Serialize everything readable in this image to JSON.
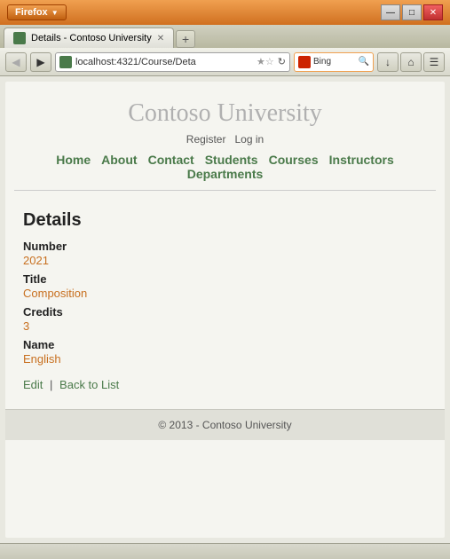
{
  "browser": {
    "firefox_label": "Firefox",
    "dropdown_arrow": "▼",
    "tab": {
      "label": "Details - Contoso University",
      "favicon_color": "#4a7a4a"
    },
    "new_tab_label": "+",
    "address": "localhost:4321/Course/Deta",
    "search_engine": "Bing",
    "window_controls": {
      "minimize": "—",
      "maximize": "□",
      "close": "✕"
    },
    "nav": {
      "back": "◀",
      "forward": "▶",
      "reload": "↺",
      "home": "⌂",
      "more1": "↓",
      "more2": "☰"
    }
  },
  "page": {
    "site_title": "Contoso University",
    "auth": {
      "register": "Register",
      "login": "Log in"
    },
    "nav_links": [
      "Home",
      "About",
      "Contact",
      "Students",
      "Courses",
      "Instructors",
      "Departments"
    ],
    "heading": "Details",
    "fields": [
      {
        "label": "Number",
        "value": "2021"
      },
      {
        "label": "Title",
        "value": "Composition"
      },
      {
        "label": "Credits",
        "value": "3"
      },
      {
        "label": "Name",
        "value": "English"
      }
    ],
    "actions": {
      "edit": "Edit",
      "separator": "|",
      "back_to_list": "Back to List"
    },
    "footer": "© 2013 - Contoso University"
  }
}
